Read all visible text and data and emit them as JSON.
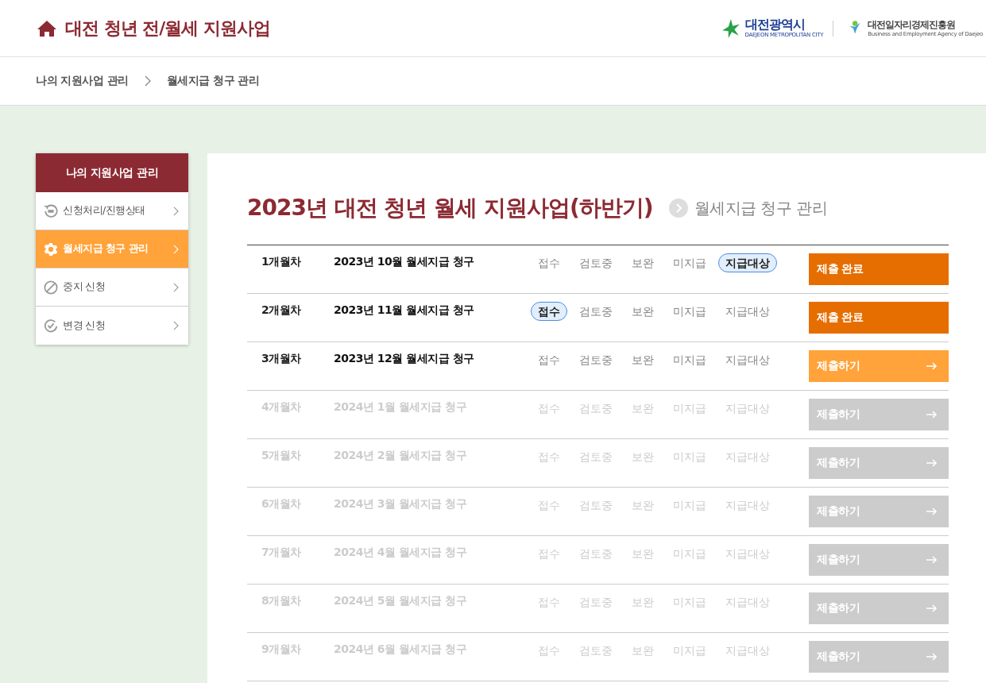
{
  "header": {
    "title": "대전 청년 전/월세 지원사업",
    "logo_city": {
      "name": "대전광역시",
      "subtitle": "DAEJEON METROPOLITAN CITY"
    },
    "logo_agency": {
      "name": "대전일자리경제진흥원",
      "subtitle": "Business and Employment Agency of Daejeo"
    }
  },
  "breadcrumb": [
    "나의 지원사업 관리",
    "월세지급 청구 관리"
  ],
  "sidebar": {
    "title": "나의 지원사업 관리",
    "items": [
      {
        "label": "신청처리/진행상태",
        "kind": "status",
        "selected": false
      },
      {
        "label": "월세지급 청구 관리",
        "kind": "settings",
        "selected": true
      },
      {
        "label": "중지 신청",
        "kind": "stop",
        "selected": false
      },
      {
        "label": "변경 신청",
        "kind": "change",
        "selected": false
      }
    ]
  },
  "page": {
    "title": "2023년 대전 청년 월세 지원사업(하반기)",
    "subtitle": "월세지급 청구 관리"
  },
  "rows": [
    {
      "month": "1개월차",
      "title": "2023년 10월 월세지급 청구",
      "disabled": false,
      "statuses": [
        {
          "label": "접수",
          "selected": false
        },
        {
          "label": "검토중",
          "selected": false
        },
        {
          "label": "보완",
          "selected": false
        },
        {
          "label": "미지급",
          "selected": false
        },
        {
          "label": "지급대상",
          "selected": true
        }
      ],
      "button": {
        "label": "제출 완료",
        "kind": "done"
      }
    },
    {
      "month": "2개월차",
      "title": "2023년 11월 월세지급 청구",
      "disabled": false,
      "statuses": [
        {
          "label": "접수",
          "selected": true
        },
        {
          "label": "검토중",
          "selected": false
        },
        {
          "label": "보완",
          "selected": false
        },
        {
          "label": "미지급",
          "selected": false
        },
        {
          "label": "지급대상",
          "selected": false
        }
      ],
      "button": {
        "label": "제출 완료",
        "kind": "done"
      }
    },
    {
      "month": "3개월차",
      "title": "2023년 12월 월세지급 청구",
      "disabled": false,
      "statuses": [
        {
          "label": "접수",
          "selected": false
        },
        {
          "label": "검토중",
          "selected": false
        },
        {
          "label": "보완",
          "selected": false
        },
        {
          "label": "미지급",
          "selected": false
        },
        {
          "label": "지급대상",
          "selected": false
        }
      ],
      "button": {
        "label": "제출하기",
        "kind": "submit"
      }
    },
    {
      "month": "4개월차",
      "title": "2024년 1월 월세지급 청구",
      "disabled": true,
      "statuses": [
        {
          "label": "접수",
          "selected": false
        },
        {
          "label": "검토중",
          "selected": false
        },
        {
          "label": "보완",
          "selected": false
        },
        {
          "label": "미지급",
          "selected": false
        },
        {
          "label": "지급대상",
          "selected": false
        }
      ],
      "button": {
        "label": "제출하기",
        "kind": "submit"
      }
    },
    {
      "month": "5개월차",
      "title": "2024년 2월 월세지급 청구",
      "disabled": true,
      "statuses": [
        {
          "label": "접수",
          "selected": false
        },
        {
          "label": "검토중",
          "selected": false
        },
        {
          "label": "보완",
          "selected": false
        },
        {
          "label": "미지급",
          "selected": false
        },
        {
          "label": "지급대상",
          "selected": false
        }
      ],
      "button": {
        "label": "제출하기",
        "kind": "submit"
      }
    },
    {
      "month": "6개월차",
      "title": "2024년 3월 월세지급 청구",
      "disabled": true,
      "statuses": [
        {
          "label": "접수",
          "selected": false
        },
        {
          "label": "검토중",
          "selected": false
        },
        {
          "label": "보완",
          "selected": false
        },
        {
          "label": "미지급",
          "selected": false
        },
        {
          "label": "지급대상",
          "selected": false
        }
      ],
      "button": {
        "label": "제출하기",
        "kind": "submit"
      }
    },
    {
      "month": "7개월차",
      "title": "2024년 4월 월세지급 청구",
      "disabled": true,
      "statuses": [
        {
          "label": "접수",
          "selected": false
        },
        {
          "label": "검토중",
          "selected": false
        },
        {
          "label": "보완",
          "selected": false
        },
        {
          "label": "미지급",
          "selected": false
        },
        {
          "label": "지급대상",
          "selected": false
        }
      ],
      "button": {
        "label": "제출하기",
        "kind": "submit"
      }
    },
    {
      "month": "8개월차",
      "title": "2024년 5월 월세지급 청구",
      "disabled": true,
      "statuses": [
        {
          "label": "접수",
          "selected": false
        },
        {
          "label": "검토중",
          "selected": false
        },
        {
          "label": "보완",
          "selected": false
        },
        {
          "label": "미지급",
          "selected": false
        },
        {
          "label": "지급대상",
          "selected": false
        }
      ],
      "button": {
        "label": "제출하기",
        "kind": "submit"
      }
    },
    {
      "month": "9개월차",
      "title": "2024년 6월 월세지급 청구",
      "disabled": true,
      "statuses": [
        {
          "label": "접수",
          "selected": false
        },
        {
          "label": "검토중",
          "selected": false
        },
        {
          "label": "보완",
          "selected": false
        },
        {
          "label": "미지급",
          "selected": false
        },
        {
          "label": "지급대상",
          "selected": false
        }
      ],
      "button": {
        "label": "제출하기",
        "kind": "submit"
      }
    }
  ]
}
